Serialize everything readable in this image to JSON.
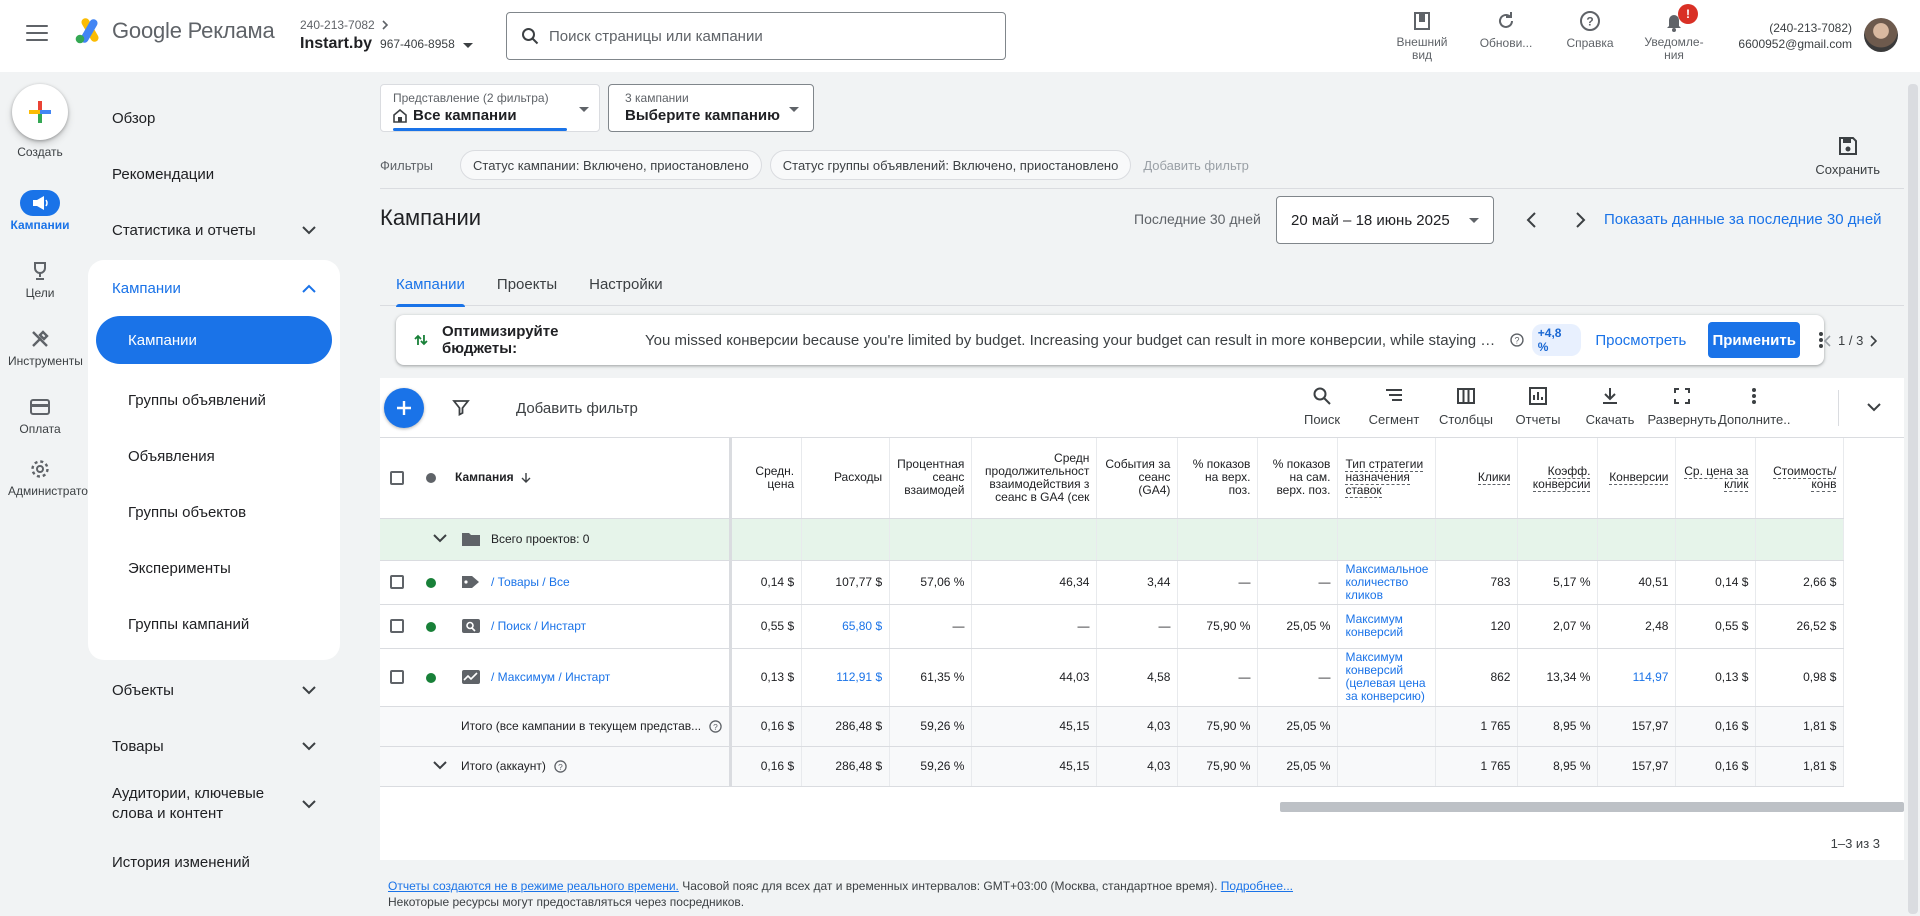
{
  "app": {
    "logo_text": "Google Реклама",
    "account_id": "240-213-7082",
    "account_name": "Instart.by",
    "account_sub": "967-406-8958",
    "search_placeholder": "Поиск страницы или кампании"
  },
  "top_actions": [
    {
      "label": "Внешний вид",
      "icon": "appearance-icon"
    },
    {
      "label": "Обнови...",
      "icon": "refresh-icon"
    },
    {
      "label": "Справка",
      "icon": "help-icon"
    },
    {
      "label": "Уведомле-ния",
      "icon": "bell-icon",
      "badge": "!"
    }
  ],
  "user": {
    "phone": "(240-213-7082)",
    "email": "6600952@gmail.com"
  },
  "rail": {
    "create_label": "Создать",
    "items": [
      {
        "label": "Кампании",
        "icon": "megaphone-icon",
        "active": true
      },
      {
        "label": "Цели",
        "icon": "trophy-icon"
      },
      {
        "label": "Инструменты",
        "icon": "tools-icon"
      },
      {
        "label": "Оплата",
        "icon": "card-icon"
      },
      {
        "label": "Администратор",
        "icon": "gear-icon"
      }
    ]
  },
  "nav": {
    "overview": "Обзор",
    "recommendations": "Рекомендации",
    "stats": "Статистика и отчеты",
    "campaigns": "Кампании",
    "sub": [
      "Кампании",
      "Группы объявлений",
      "Объявления",
      "Группы объектов",
      "Эксперименты",
      "Группы кампаний"
    ],
    "assets": "Объекты",
    "products": "Товары",
    "audiences": "Аудитории, ключевые слова и контент",
    "history": "История изменений"
  },
  "view": {
    "small": "Представление (2 фильтра)",
    "value": "Все кампании"
  },
  "campaign_picker": {
    "small": "3 кампании",
    "value": "Выберите кампанию"
  },
  "filters": {
    "label": "Фильтры",
    "chips": [
      "Статус кампании: Включено, приостановлено",
      "Статус группы объявлений: Включено, приостановлено"
    ],
    "add": "Добавить фильтр"
  },
  "save_label": "Сохранить",
  "page_title": "Кампании",
  "date": {
    "label": "Последние 30 дней",
    "range": "20 май – 18 июнь 2025",
    "show_link": "Показать данные за последние 30 дней"
  },
  "tabs": [
    "Кампании",
    "Проекты",
    "Настройки"
  ],
  "reco": {
    "title": "Оптимизируйте бюджеты:",
    "desc": "You missed конверсии because you're limited by budget. Increasing your budget can result in more конверсии, while staying wit...",
    "pct": "+4,8 %",
    "view": "Просмотреть",
    "apply": "Применить",
    "pager": "1 / 3"
  },
  "toolbar": {
    "add_filter": "Добавить фильтр",
    "tools": [
      {
        "label": "Поиск",
        "icon": "search-icon"
      },
      {
        "label": "Сегмент",
        "icon": "segment-icon"
      },
      {
        "label": "Столбцы",
        "icon": "columns-icon"
      },
      {
        "label": "Отчеты",
        "icon": "reports-icon"
      },
      {
        "label": "Скачать",
        "icon": "download-icon"
      },
      {
        "label": "Развернуть",
        "icon": "expand-icon"
      },
      {
        "label": "Дополните...",
        "icon": "more-icon"
      }
    ]
  },
  "table": {
    "headers": {
      "campaign": "Кампания",
      "avg_price": "Средн. цена",
      "cost": "Расходы",
      "engaged_pct": "Процентная сеанс взаимодей",
      "avg_duration": "Средн продолжительност взаимодействия з сеанс в GA4 (сек",
      "events": "События за сеанс (GA4)",
      "top_pct": "% показов на верх. поз.",
      "abs_top_pct": "% показов на сам. верх. поз.",
      "strategy": "Тип стратегии назначения ставок",
      "clicks": "Клики",
      "conv_rate": "Коэфф. конверсии",
      "conversions": "Конверсии",
      "avg_cpc": "Ср. цена за клик",
      "cost_conv": "Стоимость/ конв"
    },
    "projects_row": "Всего проектов: 0",
    "rows": [
      {
        "name": "/ Товары / Все",
        "icon": "tag-icon",
        "avg_price": "0,14 $",
        "cost": "107,77 $",
        "cost_link": false,
        "engaged_pct": "57,06 %",
        "avg_duration": "46,34",
        "events": "3,44",
        "top_pct": "—",
        "abs_top_pct": "—",
        "strategy": "Максимальное количество кликов",
        "clicks": "783",
        "conv_rate": "5,17 %",
        "conversions": "40,51",
        "conv_link": false,
        "avg_cpc": "0,14 $",
        "cost_conv": "2,66 $"
      },
      {
        "name": "/ Поиск / Инстарт",
        "icon": "search-campaign-icon",
        "avg_price": "0,55 $",
        "cost": "65,80 $",
        "cost_link": true,
        "engaged_pct": "—",
        "avg_duration": "—",
        "events": "—",
        "top_pct": "75,90 %",
        "abs_top_pct": "25,05 %",
        "strategy": "Максимум конверсий",
        "clicks": "120",
        "conv_rate": "2,07 %",
        "conversions": "2,48",
        "conv_link": false,
        "avg_cpc": "0,55 $",
        "cost_conv": "26,52 $"
      },
      {
        "name": "/ Максимум / Инстарт",
        "icon": "pmax-icon",
        "avg_price": "0,13 $",
        "cost": "112,91 $",
        "cost_link": true,
        "engaged_pct": "61,35 %",
        "avg_duration": "44,03",
        "events": "4,58",
        "top_pct": "—",
        "abs_top_pct": "—",
        "strategy": "Максимум конверсий (целевая цена за конверсию)",
        "clicks": "862",
        "conv_rate": "13,34 %",
        "conversions": "114,97",
        "conv_link": true,
        "avg_cpc": "0,13 $",
        "cost_conv": "0,98 $"
      }
    ],
    "totals": [
      {
        "label": "Итого (все кампании в текущем представ...",
        "avg_price": "0,16 $",
        "cost": "286,48 $",
        "engaged_pct": "59,26 %",
        "avg_duration": "45,15",
        "events": "4,03",
        "top_pct": "75,90 %",
        "abs_top_pct": "25,05 %",
        "clicks": "1 765",
        "conv_rate": "8,95 %",
        "conversions": "157,97",
        "avg_cpc": "0,16 $",
        "cost_conv": "1,81 $"
      },
      {
        "label": "Итого (аккаунт)",
        "avg_price": "0,16 $",
        "cost": "286,48 $",
        "engaged_pct": "59,26 %",
        "avg_duration": "45,15",
        "events": "4,03",
        "top_pct": "75,90 %",
        "abs_top_pct": "25,05 %",
        "clicks": "1 765",
        "conv_rate": "8,95 %",
        "conversions": "157,97",
        "avg_cpc": "0,16 $",
        "cost_conv": "1,81 $"
      }
    ],
    "rows_count": "1–3 из 3"
  },
  "footer": {
    "link1": "Отчеты создаются не в режиме реального времени.",
    "text1": " Часовой пояс для всех дат и временных интервалов: GMT+03:00 (Москва, стандартное время). ",
    "link2": "Подробнее...",
    "text2": "Некоторые ресурсы могут предоставляться через посредников."
  },
  "colors": {
    "accent": "#1a73e8",
    "status_enabled": "#188038",
    "project_row": "#e6f4ea"
  }
}
